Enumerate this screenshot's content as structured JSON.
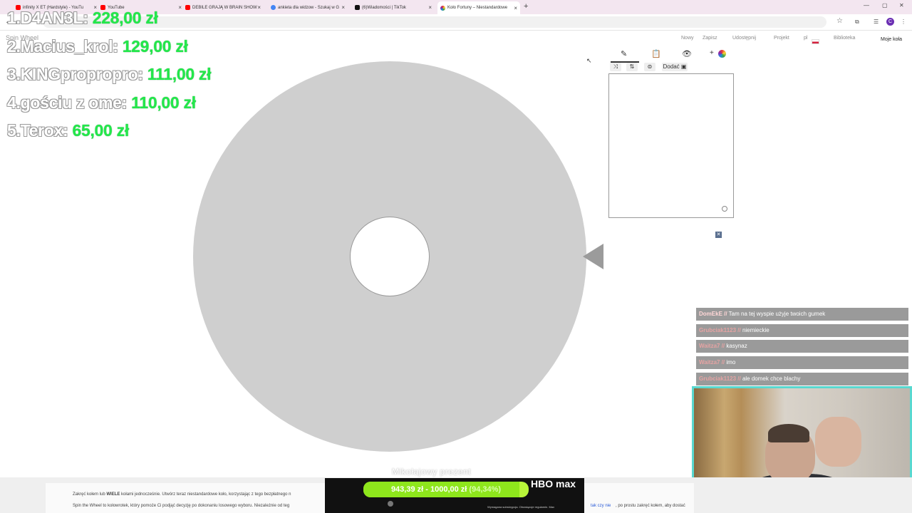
{
  "browser": {
    "tabs": [
      {
        "title": "infinity X ET (Hardstyle) - YouTu",
        "color": "#ff0000"
      },
      {
        "title": "YouTube",
        "color": "#ff0000"
      },
      {
        "title": "DEBILE GRAJĄ W BRAIN SHOW",
        "color": "#ff0000"
      },
      {
        "title": "ankieta dla widzow - Szukaj w G",
        "color": "#4285f4"
      },
      {
        "title": "(6)Wiadomości | TikTok",
        "color": "#111111"
      },
      {
        "title": "Koło Fortuny – Niestandardowe",
        "color": "#9c27b0"
      }
    ],
    "new_tab": "+",
    "close_glyph": "×",
    "back_glyph": "←",
    "star_glyph": "☆",
    "avatar_letter": "C"
  },
  "site": {
    "logo": "Spin Wheel",
    "nav": [
      "Nowy",
      "Zapisz",
      "Udostępnij",
      "Projekt",
      "pl",
      "Biblioteka"
    ],
    "my_wheels": "Moje koła"
  },
  "leaderboard": [
    {
      "rank_name": "1.D4AN3L:",
      "amount": "228,00 zł"
    },
    {
      "rank_name": "2.Macius_krol:",
      "amount": "129,00 zł"
    },
    {
      "rank_name": "3.KINGpropropro:",
      "amount": "111,00 zł"
    },
    {
      "rank_name": "4.gościu z ome:",
      "amount": "110,00 zł"
    },
    {
      "rank_name": "5.Terox:",
      "amount": "65,00 zł"
    }
  ],
  "editor": {
    "add_label": "Dodać",
    "tool_icons": [
      "pencil-icon",
      "clipboard-icon",
      "eye-slash-icon",
      "palette-icon"
    ],
    "action_icons": [
      "shuffle-icon",
      "sort-icon",
      "coin-icon"
    ]
  },
  "chat": [
    {
      "user": "DomEkE //",
      "msg": "Tam na tej wyspie użyje twoich gumek"
    },
    {
      "user": "Grubciak1123 //",
      "msg": "niemieckie"
    },
    {
      "user": "Waitza7 //",
      "msg": "kasynaz"
    },
    {
      "user": "Waitza7 //",
      "msg": "imo"
    },
    {
      "user": "Grubciak1123 //",
      "msg": "ale domek chce blachy"
    }
  ],
  "goal": {
    "title": "Mikołajowy prezent",
    "current": "943,39 zł",
    "target": "1000,00 zł",
    "percent_label": "(94,34%)",
    "progress": 0.9434,
    "sponsor_logo": "HBO max",
    "sponsor_note": "Wymagana subskrypcja. Obowiązuje regulamin. Max"
  },
  "description": {
    "line1_a": "Zakręć kołem lub",
    "line1_b": "WIELE",
    "line1_c": "kołami jednocześnie. Utwórz teraz niestandardowe koło, korzystając z tego bezpłatnego n",
    "line2": "Spin the Wheel to kołowrotek, który pomoże Ci podjąć decyzję po dokonaniu losowego wyboru. Niezależnie od teg",
    "link": "tak czy nie",
    "line2_end": ", po prostu zakręć kołem, aby dostać"
  },
  "colors": {
    "wheel": "#cfcfcf",
    "leader_amount": "#22e84a",
    "goal_bar": "#b8f53a",
    "chat_bg": "#9a9a9a",
    "cam_border": "#59d8d0"
  }
}
